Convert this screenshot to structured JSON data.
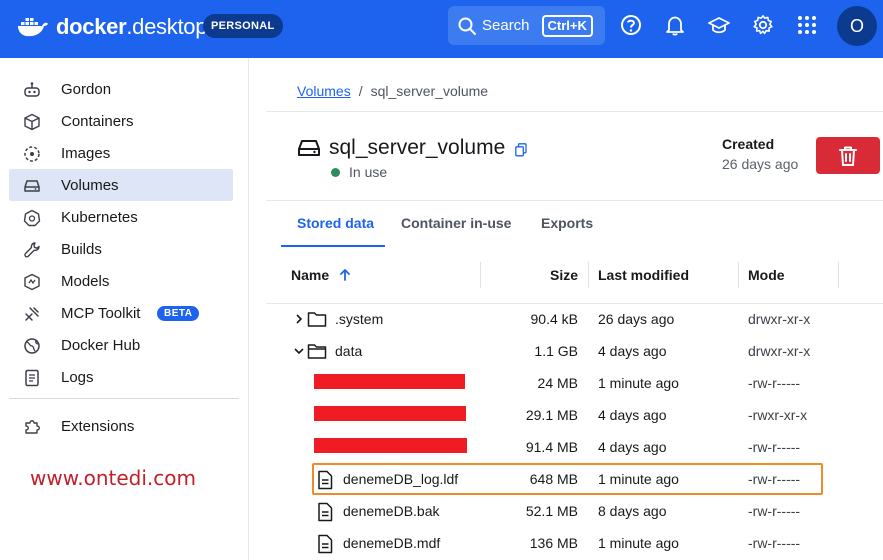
{
  "topbar": {
    "brand_bold": "docker",
    "brand_light": ".desktop",
    "plan_badge": "PERSONAL",
    "search_label": "Search",
    "search_shortcut": "Ctrl+K",
    "avatar_initial": "O"
  },
  "sidebar": {
    "items": [
      {
        "label": "Gordon",
        "icon": "gordon-icon"
      },
      {
        "label": "Containers",
        "icon": "cube-icon"
      },
      {
        "label": "Images",
        "icon": "image-icon"
      },
      {
        "label": "Volumes",
        "icon": "volume-drive-icon"
      },
      {
        "label": "Kubernetes",
        "icon": "helm-wheel-icon"
      },
      {
        "label": "Builds",
        "icon": "wrench-icon"
      },
      {
        "label": "Models",
        "icon": "model-box-icon"
      },
      {
        "label": "MCP Toolkit",
        "icon": "toolkit-icon",
        "badge": "BETA"
      },
      {
        "label": "Docker Hub",
        "icon": "globe-icon"
      },
      {
        "label": "Logs",
        "icon": "log-icon"
      },
      {
        "label": "Extensions",
        "icon": "puzzle-icon"
      }
    ],
    "active_item": "Volumes"
  },
  "watermark": "www.ontedi.com",
  "breadcrumb": {
    "root": "Volumes",
    "separator": "/",
    "current": "sql_server_volume"
  },
  "volume": {
    "name": "sql_server_volume",
    "status": "In use",
    "created_label": "Created",
    "created_value": "26 days ago"
  },
  "tabs": [
    {
      "label": "Stored data",
      "active": true
    },
    {
      "label": "Container in-use",
      "active": false
    },
    {
      "label": "Exports",
      "active": false
    }
  ],
  "table": {
    "headers": {
      "name": "Name",
      "size": "Size",
      "modified": "Last modified",
      "mode": "Mode"
    },
    "rows": [
      {
        "name": ".system",
        "type": "folder",
        "expanded": false,
        "size": "90.4 kB",
        "modified": "26 days ago",
        "mode": "drwxr-xr-x"
      },
      {
        "name": "data",
        "type": "folder",
        "expanded": true,
        "size": "1.1 GB",
        "modified": "4 days ago",
        "mode": "drwxr-xr-x"
      },
      {
        "name": "",
        "type": "redacted",
        "size": "24 MB",
        "modified": "1 minute ago",
        "mode": "-rw-r-----"
      },
      {
        "name": "",
        "type": "redacted",
        "size": "29.1 MB",
        "modified": "4 days ago",
        "mode": "-rwxr-xr-x"
      },
      {
        "name": "",
        "type": "redacted",
        "size": "91.4 MB",
        "modified": "4 days ago",
        "mode": "-rw-r-----"
      },
      {
        "name": "denemeDB_log.ldf",
        "type": "file",
        "highlighted": true,
        "size": "648 MB",
        "modified": "1 minute ago",
        "mode": "-rw-r-----"
      },
      {
        "name": "denemeDB.bak",
        "type": "file",
        "size": "52.1 MB",
        "modified": "8 days ago",
        "mode": "-rw-r-----"
      },
      {
        "name": "denemeDB.mdf",
        "type": "file",
        "size": "136 MB",
        "modified": "1 minute ago",
        "mode": "-rw-r-----"
      }
    ]
  },
  "colors": {
    "brand_blue": "#1d63ed",
    "delete_red": "#d92a37",
    "status_green": "#2f8a5f",
    "highlight_orange": "#f08a24",
    "redaction_red": "#ef1c24"
  }
}
